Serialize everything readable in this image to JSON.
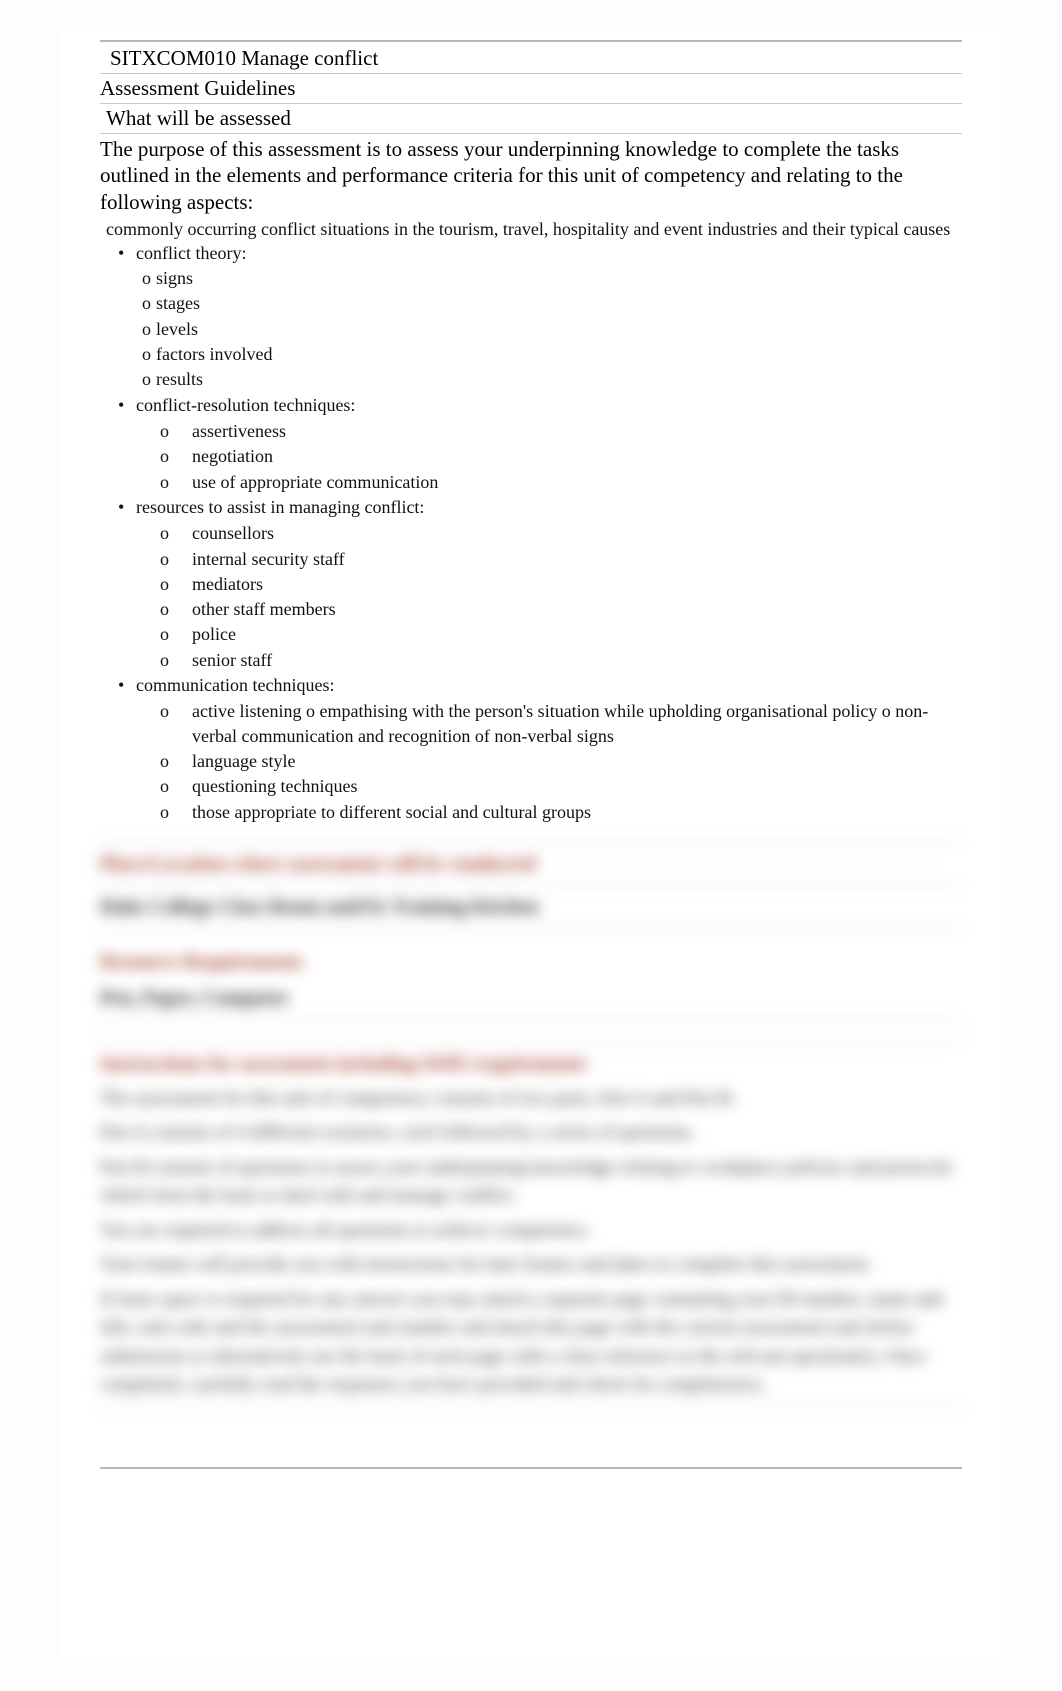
{
  "unit_title": "SITXCOM010 Manage conflict",
  "section_title": "Assessment Guidelines",
  "sub_title": "What will be assessed",
  "purpose": "The purpose of this assessment is to assess your underpinning knowledge to complete the tasks outlined in the elements and performance criteria for this unit of competency and relating to the following aspects:",
  "intro_line": "commonly occurring conflict situations in the tourism, travel, hospitality and event industries and their typical causes",
  "bullets": [
    {
      "label": "conflict theory:",
      "tight": true,
      "subs": [
        "signs",
        "stages",
        "levels",
        "factors involved",
        "results"
      ]
    },
    {
      "label": "conflict-resolution techniques:",
      "tight": false,
      "subs": [
        "assertiveness",
        "negotiation",
        "use of appropriate communication"
      ]
    },
    {
      "label": "resources to assist in managing conflict:",
      "tight": false,
      "subs": [
        "counsellors",
        "internal security staff",
        "mediators",
        "other staff members",
        "police",
        "senior staff"
      ]
    },
    {
      "label": "communication techniques:",
      "tight": false,
      "subs": [
        "active listening o empathising with the person's situation while upholding organisational policy o non-verbal communication and recognition of non-verbal signs",
        "language style",
        "questioning techniques",
        "those appropriate to different social and cultural groups"
      ]
    }
  ],
  "blurred": {
    "h1": "Place/Location where assessment will be conducted",
    "h2": "Duke College Class Room and/Or Training Kitchen",
    "h3": "Resource Requirements",
    "h4": "Pen, Paper, Computer",
    "h5": "Instructions for assessment including WHS requirements",
    "p1": "The assessment for this unit of competency consists of two parts, Part A and Part B.",
    "p2": "Part A consists of 4 different scenarios, each followed by a series of questions.",
    "p3": "Part B consists of questions to assess your underpinning knowledge relating to workplace policies and protocols which form the basis to deal with and manage conflict.",
    "p4": "You are required to address all questions to achieve competence.",
    "p5": "Your trainer will provide you with instructions for time frames and dates to complete this assessment.",
    "p6": "If more space is required for any answer you may attach a separate page containing your ID number, name and title, unit code and the assessment task number and attach this page with the current assessment task before submission or alternatively use the back of each page with a clear reference to the relevant question(s). Once completed, carefully read the responses you have provided and check for completeness."
  }
}
